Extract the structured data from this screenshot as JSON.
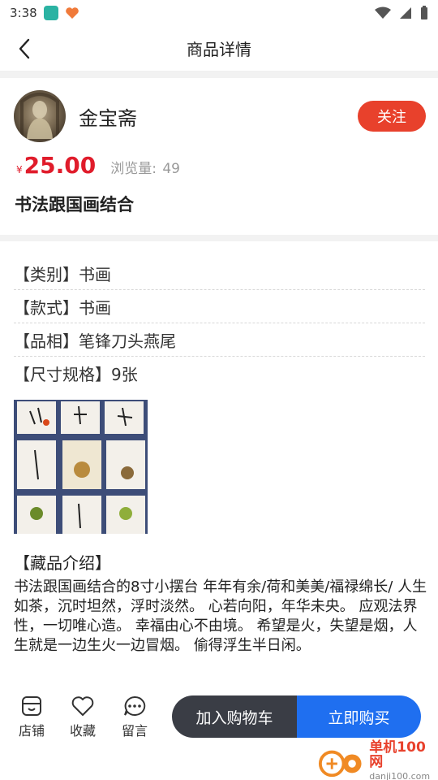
{
  "status_bar": {
    "time": "3:38"
  },
  "header": {
    "title": "商品详情"
  },
  "shop": {
    "name": "金宝斋",
    "follow_label": "关注"
  },
  "product": {
    "currency": "¥",
    "price": "25.00",
    "views_label": "浏览量:",
    "views": "49",
    "title": "书法跟国画结合"
  },
  "attributes": [
    {
      "text": "【类别】书画"
    },
    {
      "text": "【款式】书画"
    },
    {
      "text": "【品相】笔锋刀头燕尾"
    },
    {
      "text": "【尺寸规格】9张"
    }
  ],
  "description": {
    "heading": "【藏品介绍】",
    "body": "书法跟国画结合的8寸小摆台 年年有余/荷和美美/福禄绵长/ 人生如茶，沉时坦然，浮时淡然。 心若向阳，年华未央。 应观法界性，一切唯心造。 幸福由心不由境。 希望是火，失望是烟，人生就是一边生火一边冒烟。 偷得浮生半日闲。"
  },
  "bottom_bar": {
    "shop_label": "店铺",
    "favorite_label": "收藏",
    "message_label": "留言",
    "cart_label": "加入购物车",
    "buy_label": "立即购买"
  },
  "watermark": {
    "name": "单机100网",
    "url": "danji100.com"
  },
  "colors": {
    "accent_red": "#e8412c",
    "price_red": "#e01c2b",
    "buy_blue": "#1f6ff0",
    "cart_dark": "#3a3d45"
  },
  "icons": [
    "back-arrow-icon",
    "store-icon",
    "heart-icon",
    "chat-icon",
    "wifi-icon",
    "signal-icon",
    "battery-icon"
  ]
}
